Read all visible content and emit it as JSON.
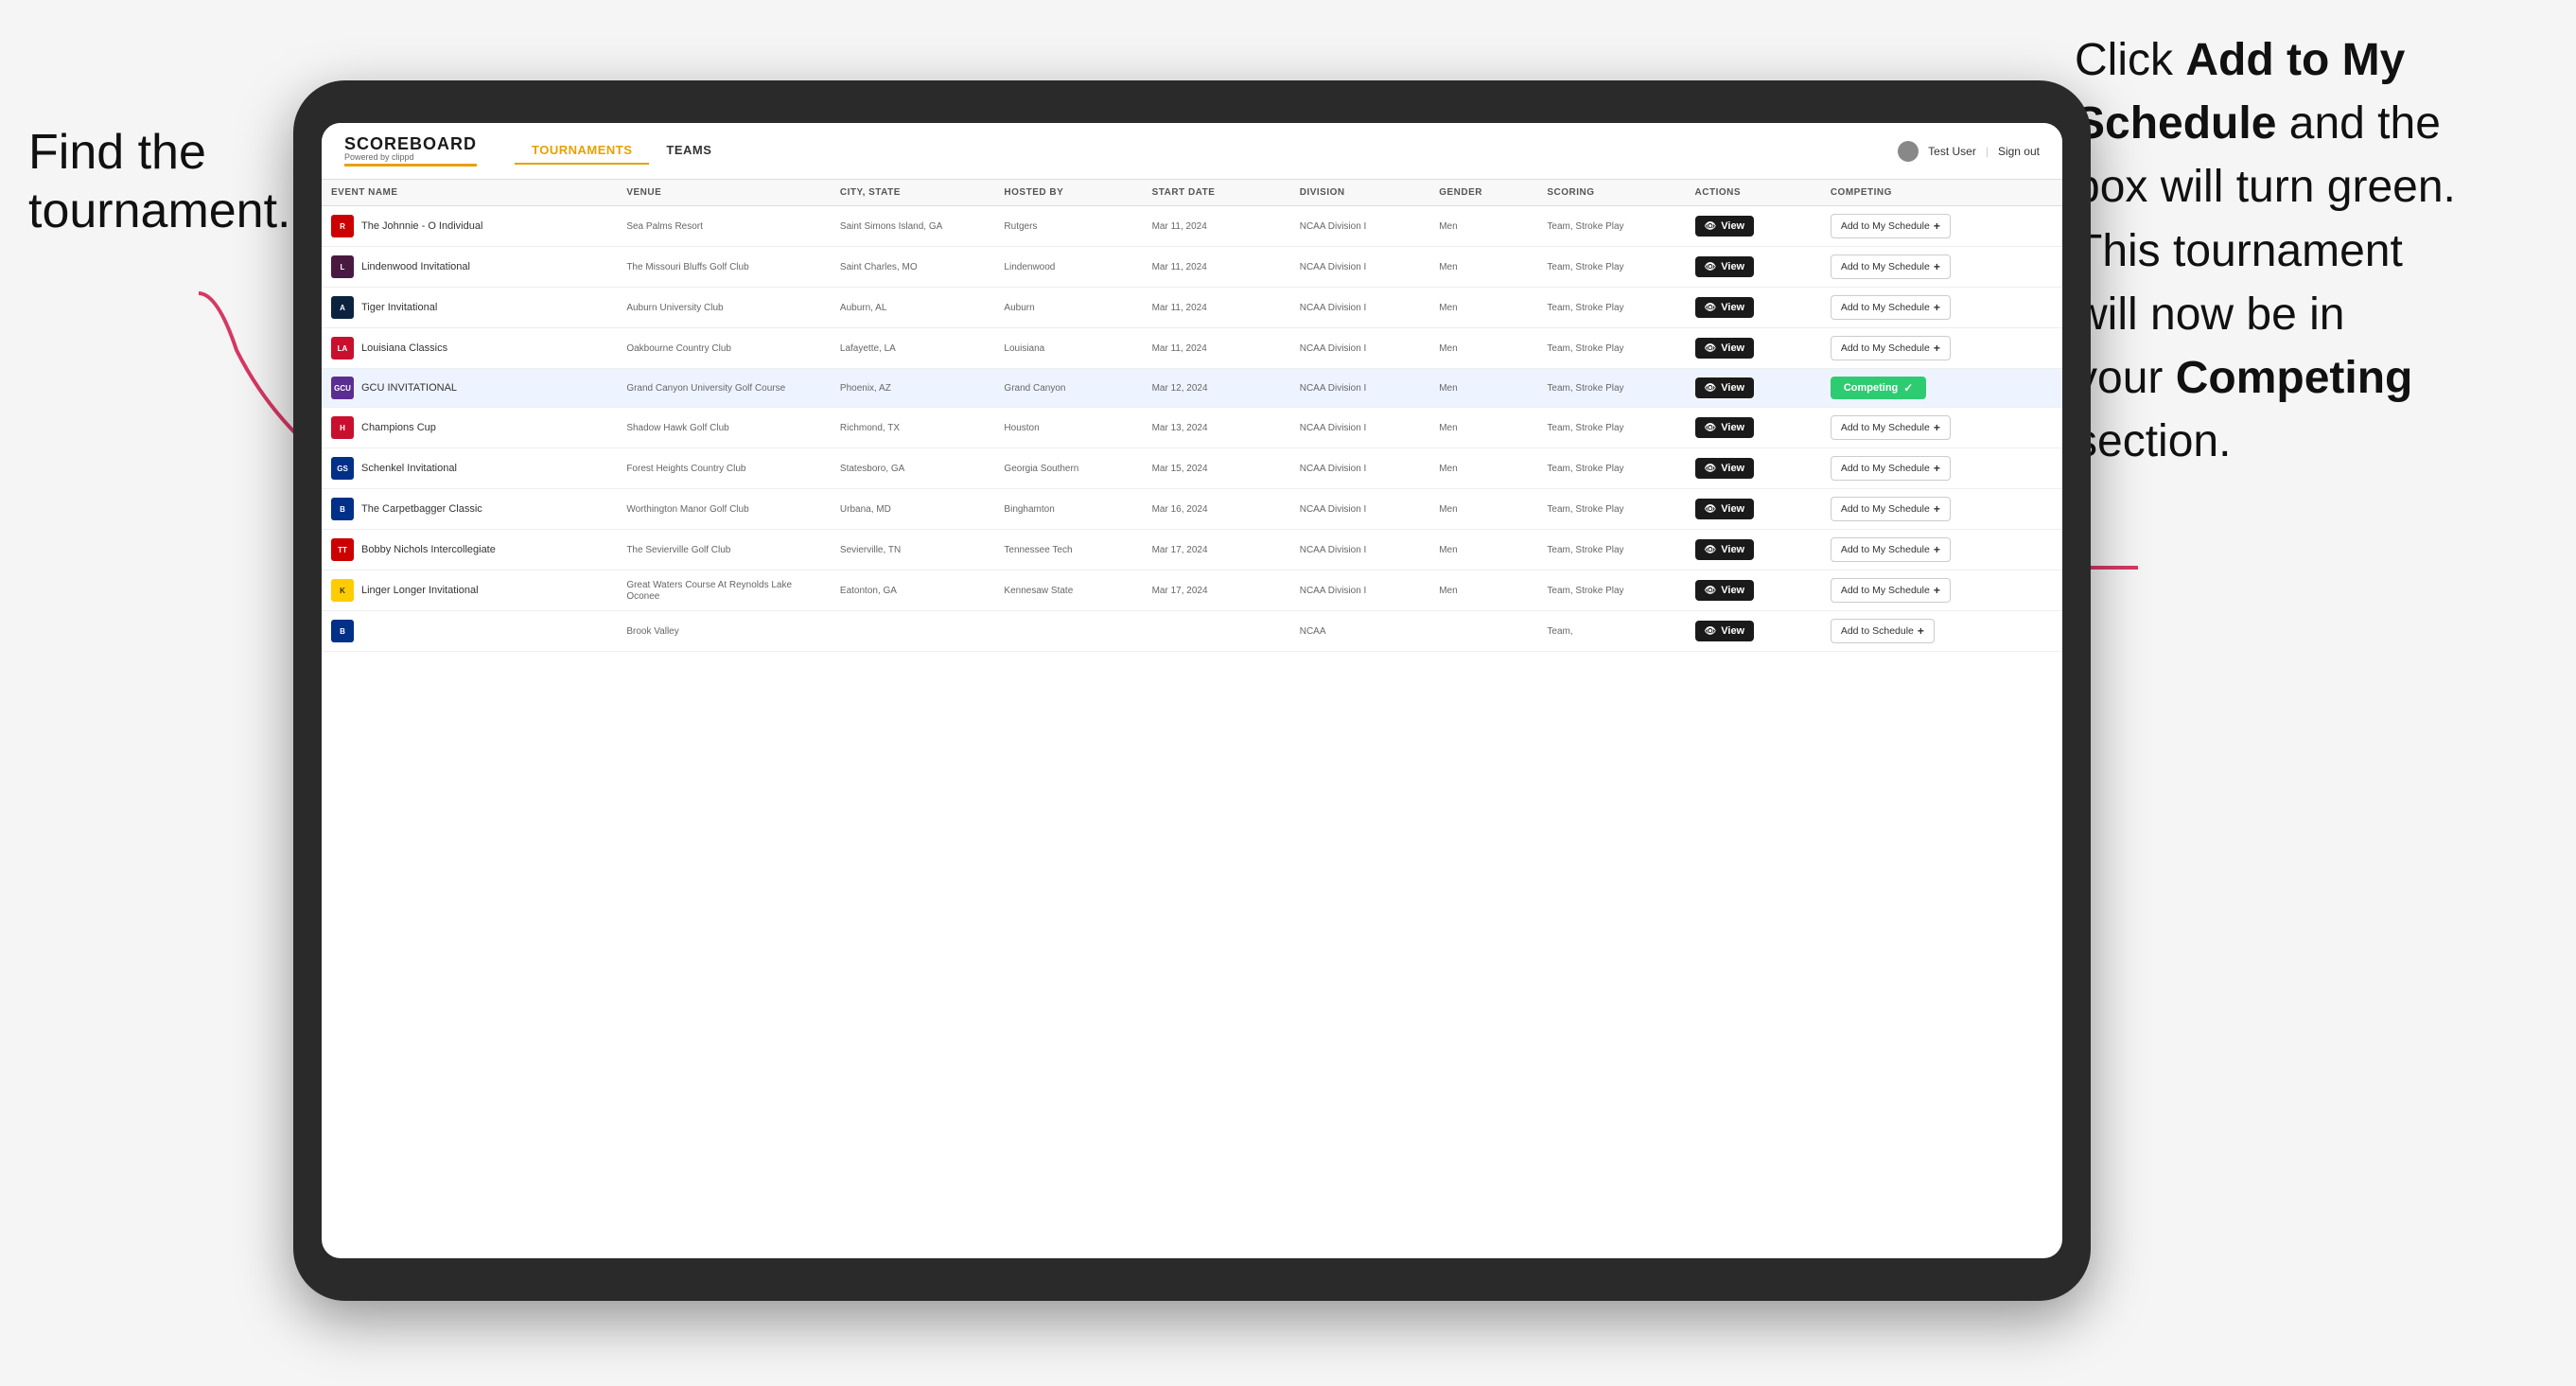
{
  "annotations": {
    "left": "Find the\ntournament.",
    "right_line1": "Click ",
    "right_bold1": "Add to My\nSchedule",
    "right_line2": " and the\nbox will turn green.\nThis tournament\nwill now be in\nyour ",
    "right_bold2": "Competing",
    "right_line3": "\nsection."
  },
  "header": {
    "logo": "SCOREBOARD",
    "logo_sub": "Powered by clippd",
    "nav": [
      "TOURNAMENTS",
      "TEAMS"
    ],
    "active_nav": "TOURNAMENTS",
    "user": "Test User",
    "sign_out": "Sign out"
  },
  "table": {
    "columns": [
      "EVENT NAME",
      "VENUE",
      "CITY, STATE",
      "HOSTED BY",
      "START DATE",
      "DIVISION",
      "GENDER",
      "SCORING",
      "ACTIONS",
      "COMPETING"
    ],
    "rows": [
      {
        "id": 1,
        "logo_type": "r",
        "logo_letter": "R",
        "event": "The Johnnie - O Individual",
        "venue": "Sea Palms Resort",
        "city": "Saint Simons Island, GA",
        "hosted": "Rutgers",
        "start": "Mar 11, 2024",
        "division": "NCAA Division I",
        "gender": "Men",
        "scoring": "Team, Stroke Play",
        "action_label": "View",
        "competing_label": "Add to My Schedule",
        "is_competing": false,
        "highlighted": false
      },
      {
        "id": 2,
        "logo_type": "l",
        "logo_letter": "L",
        "event": "Lindenwood Invitational",
        "venue": "The Missouri Bluffs Golf Club",
        "city": "Saint Charles, MO",
        "hosted": "Lindenwood",
        "start": "Mar 11, 2024",
        "division": "NCAA Division I",
        "gender": "Men",
        "scoring": "Team, Stroke Play",
        "action_label": "View",
        "competing_label": "Add to My Schedule",
        "is_competing": false,
        "highlighted": false
      },
      {
        "id": 3,
        "logo_type": "au",
        "logo_letter": "A",
        "event": "Tiger Invitational",
        "venue": "Auburn University Club",
        "city": "Auburn, AL",
        "hosted": "Auburn",
        "start": "Mar 11, 2024",
        "division": "NCAA Division I",
        "gender": "Men",
        "scoring": "Team, Stroke Play",
        "action_label": "View",
        "competing_label": "Add to My Schedule",
        "is_competing": false,
        "highlighted": false
      },
      {
        "id": 4,
        "logo_type": "la",
        "logo_letter": "LA",
        "event": "Louisiana Classics",
        "venue": "Oakbourne Country Club",
        "city": "Lafayette, LA",
        "hosted": "Louisiana",
        "start": "Mar 11, 2024",
        "division": "NCAA Division I",
        "gender": "Men",
        "scoring": "Team, Stroke Play",
        "action_label": "View",
        "competing_label": "Add to My Schedule",
        "is_competing": false,
        "highlighted": false
      },
      {
        "id": 5,
        "logo_type": "gcu",
        "logo_letter": "GCU",
        "event": "GCU INVITATIONAL",
        "venue": "Grand Canyon University Golf Course",
        "city": "Phoenix, AZ",
        "hosted": "Grand Canyon",
        "start": "Mar 12, 2024",
        "division": "NCAA Division I",
        "gender": "Men",
        "scoring": "Team, Stroke Play",
        "action_label": "View",
        "competing_label": "Competing",
        "is_competing": true,
        "highlighted": true
      },
      {
        "id": 6,
        "logo_type": "h",
        "logo_letter": "H",
        "event": "Champions Cup",
        "venue": "Shadow Hawk Golf Club",
        "city": "Richmond, TX",
        "hosted": "Houston",
        "start": "Mar 13, 2024",
        "division": "NCAA Division I",
        "gender": "Men",
        "scoring": "Team, Stroke Play",
        "action_label": "View",
        "competing_label": "Add to My Schedule",
        "is_competing": false,
        "highlighted": false
      },
      {
        "id": 7,
        "logo_type": "gs",
        "logo_letter": "GS",
        "event": "Schenkel Invitational",
        "venue": "Forest Heights Country Club",
        "city": "Statesboro, GA",
        "hosted": "Georgia Southern",
        "start": "Mar 15, 2024",
        "division": "NCAA Division I",
        "gender": "Men",
        "scoring": "Team, Stroke Play",
        "action_label": "View",
        "competing_label": "Add to My Schedule",
        "is_competing": false,
        "highlighted": false
      },
      {
        "id": 8,
        "logo_type": "b",
        "logo_letter": "B",
        "event": "The Carpetbagger Classic",
        "venue": "Worthington Manor Golf Club",
        "city": "Urbana, MD",
        "hosted": "Binghamton",
        "start": "Mar 16, 2024",
        "division": "NCAA Division I",
        "gender": "Men",
        "scoring": "Team, Stroke Play",
        "action_label": "View",
        "competing_label": "Add to My Schedule",
        "is_competing": false,
        "highlighted": false
      },
      {
        "id": 9,
        "logo_type": "tt",
        "logo_letter": "TT",
        "event": "Bobby Nichols Intercollegiate",
        "venue": "The Sevierville Golf Club",
        "city": "Sevierville, TN",
        "hosted": "Tennessee Tech",
        "start": "Mar 17, 2024",
        "division": "NCAA Division I",
        "gender": "Men",
        "scoring": "Team, Stroke Play",
        "action_label": "View",
        "competing_label": "Add to My Schedule",
        "is_competing": false,
        "highlighted": false
      },
      {
        "id": 10,
        "logo_type": "ksu",
        "logo_letter": "K",
        "event": "Linger Longer Invitational",
        "venue": "Great Waters Course At Reynolds Lake Oconee",
        "city": "Eatonton, GA",
        "hosted": "Kennesaw State",
        "start": "Mar 17, 2024",
        "division": "NCAA Division I",
        "gender": "Men",
        "scoring": "Team, Stroke Play",
        "action_label": "View",
        "competing_label": "Add to My Schedule",
        "is_competing": false,
        "highlighted": false
      },
      {
        "id": 11,
        "logo_type": "b",
        "logo_letter": "B",
        "event": "",
        "venue": "Brook Valley",
        "city": "",
        "hosted": "",
        "start": "",
        "division": "NCAA",
        "gender": "",
        "scoring": "Team,",
        "action_label": "View",
        "competing_label": "Add to Schedule",
        "is_competing": false,
        "highlighted": false,
        "partial": true
      }
    ]
  }
}
